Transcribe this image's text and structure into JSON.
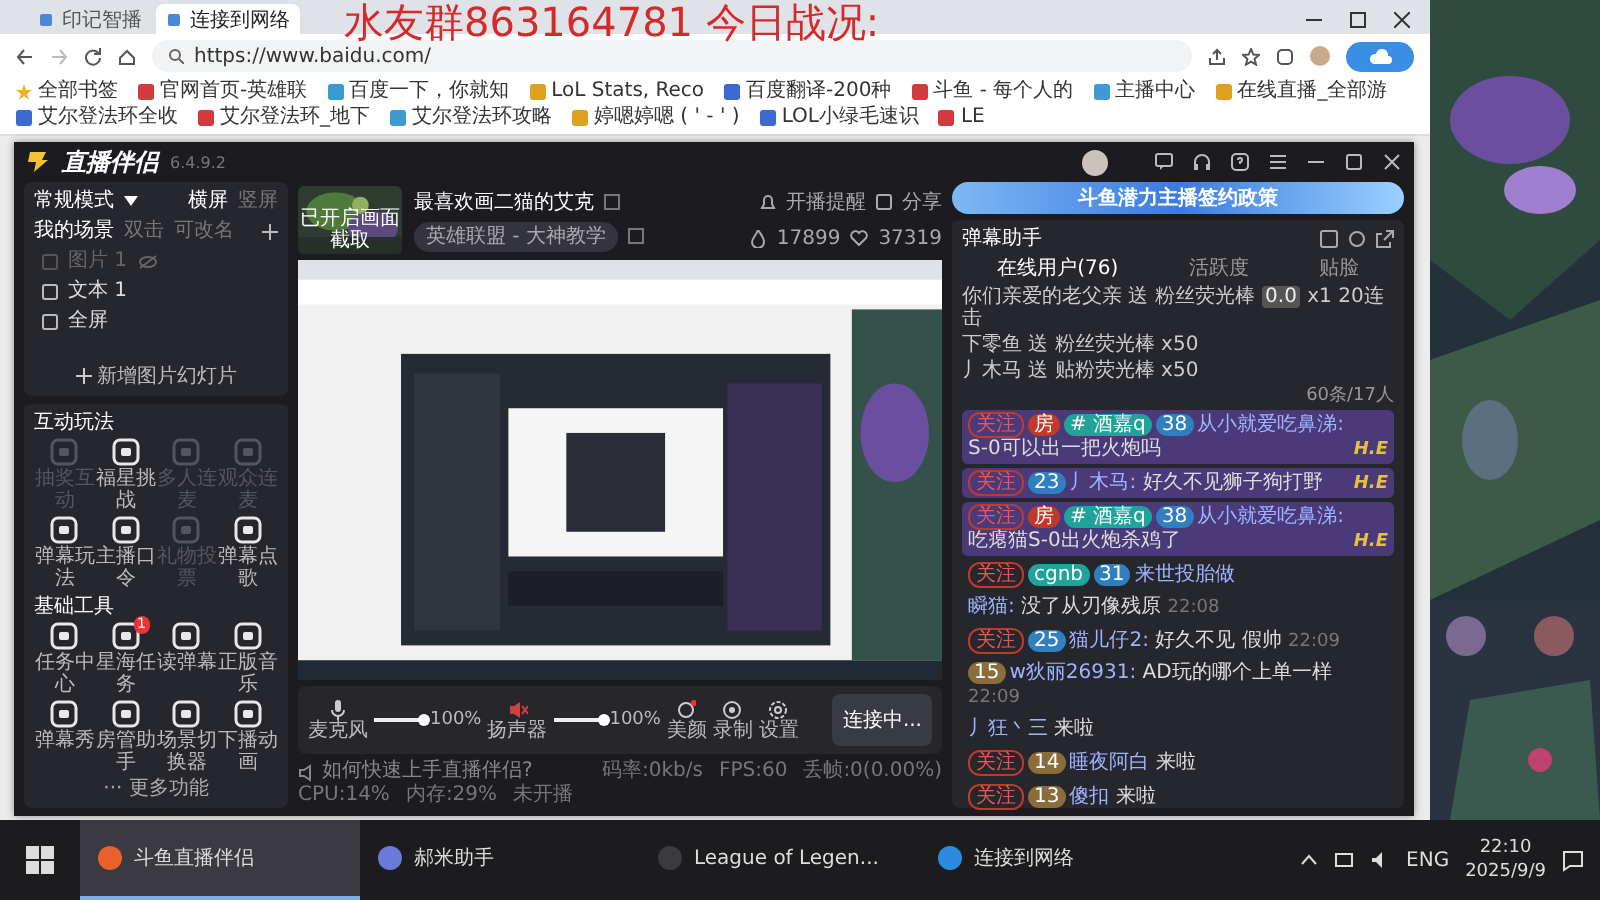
{
  "overlay_text": "水友群863164781 今日战况:",
  "browser": {
    "tabs": [
      {
        "label": "印记智播",
        "selected": false
      },
      {
        "label": "连接到网络",
        "selected": true
      }
    ],
    "url": "https://www.baidu.com/",
    "bookmarks": [
      "全部书签",
      "官网首页-英雄联",
      "百度一下，你就知",
      "LoL Stats, Reco",
      "百度翻译-200种",
      "斗鱼 - 每个人的",
      "主播中心",
      "在线直播_全部游",
      "艾尔登法环全收",
      "艾尔登法环_地下",
      "艾尔登法环攻略",
      "婷嗯婷嗯 ( ' - ' )",
      "LOL小绿毛速识",
      "LE"
    ]
  },
  "app": {
    "name": "直播伴侣",
    "version": "6.4.9.2",
    "mode": "常规模式",
    "orientations": [
      {
        "label": "横屏",
        "selected": true
      },
      {
        "label": "竖屏",
        "selected": false
      }
    ],
    "scene_tabs": [
      {
        "label": "我的场景",
        "selected": true
      },
      {
        "label": "双击",
        "selected": false
      },
      {
        "label": "可改名",
        "selected": false
      }
    ],
    "sources": [
      {
        "name": "图片 1",
        "visible": false
      },
      {
        "name": "文本 1",
        "visible": true
      },
      {
        "name": "全屏",
        "visible": true
      }
    ],
    "add_source": "新增图片幻灯片",
    "sections": [
      {
        "title": "互动玩法",
        "tools": [
          {
            "label": "抽奖互动",
            "disabled": true
          },
          {
            "label": "福星挑战",
            "disabled": false
          },
          {
            "label": "多人连麦",
            "disabled": true
          },
          {
            "label": "观众连麦",
            "disabled": true
          },
          {
            "label": "弹幕玩法",
            "disabled": false
          },
          {
            "label": "主播口令",
            "disabled": false
          },
          {
            "label": "礼物投票",
            "disabled": true
          },
          {
            "label": "弹幕点歌",
            "disabled": false
          }
        ]
      },
      {
        "title": "基础工具",
        "tools": [
          {
            "label": "任务中心",
            "disabled": false
          },
          {
            "label": "星海任务",
            "disabled": false,
            "badge": "1"
          },
          {
            "label": "读弹幕",
            "disabled": false
          },
          {
            "label": "正版音乐",
            "disabled": false
          },
          {
            "label": "弹幕秀",
            "disabled": false
          },
          {
            "label": "房管助手",
            "disabled": false
          },
          {
            "label": "场景切换器",
            "disabled": false
          },
          {
            "label": "下播动画",
            "disabled": false
          }
        ]
      }
    ],
    "more": "··· 更多功能",
    "stream": {
      "thumb_label": "已开启画面截取",
      "title": "最喜欢画二猫的艾克",
      "category": "英雄联盟 - 大神教学",
      "actions": [
        "开播提醒",
        "分享"
      ],
      "hot": "17899",
      "likes": "37319"
    },
    "audio": [
      {
        "label": "麦克风",
        "level": 1,
        "reading": "100%"
      },
      {
        "label": "扬声器",
        "level": 1,
        "reading": "100%"
      }
    ],
    "tools": [
      "美颜",
      "录制",
      "设置"
    ],
    "connect": "连接中...",
    "help": "如何快速上手直播伴侣?",
    "stats": [
      "码率:0kb/s",
      "FPS:60",
      "丢帧:0(0.00%)",
      "CPU:14%",
      "内存:29%",
      "未开播"
    ]
  },
  "chat": {
    "banner": "斗鱼潜力主播签约政策",
    "title": "弹幕助手",
    "tabs": [
      {
        "label": "在线用户(76)",
        "selected": true
      },
      {
        "label": "活跃度",
        "selected": false
      },
      {
        "label": "贴脸",
        "selected": false
      }
    ],
    "gifts": [
      {
        "text": "你们亲爱的老父亲 送 粉丝荧光棒",
        "price": "0.0",
        "count": "x1 20连击"
      },
      {
        "text": "下零鱼 送 粉丝荧光棒",
        "count": "x50"
      },
      {
        "text": "丿木马 送 贴粉荧光棒",
        "count": "x50"
      }
    ],
    "count": "60条/17人",
    "messages": [
      {
        "highlight": true,
        "badges": [
          {
            "kind": "follow",
            "text": "关注"
          },
          {
            "kind": "room",
            "text": "房"
          },
          {
            "kind": "fan",
            "text": "# 酒嘉q"
          },
          {
            "kind": "level",
            "text": "38"
          }
        ],
        "user": "从小就爱吃鼻涕:",
        "text": "S-0可以出一把火炮吗",
        "sign": "H.E"
      },
      {
        "highlight": true,
        "badges": [
          {
            "kind": "follow",
            "text": "关注"
          },
          {
            "kind": "level",
            "text": "23"
          }
        ],
        "user": "丿木马:",
        "text": "好久不见狮子狗打野",
        "sign": "H.E"
      },
      {
        "highlight": true,
        "badges": [
          {
            "kind": "follow",
            "text": "关注"
          },
          {
            "kind": "room",
            "text": "房"
          },
          {
            "kind": "fan",
            "text": "# 酒嘉q"
          },
          {
            "kind": "level",
            "text": "38"
          }
        ],
        "user": "从小就爱吃鼻涕:",
        "text": "吃瘪猫S-0出火炮杀鸡了",
        "sign": "H.E"
      },
      {
        "highlight": false,
        "badges": [
          {
            "kind": "follow",
            "text": "关注"
          },
          {
            "kind": "fan",
            "text": "cgnb"
          },
          {
            "kind": "level",
            "text": "31"
          }
        ],
        "user": "来世投胎做"
      },
      {
        "highlight": false,
        "user": "瞬猫:",
        "text": "没了从刃像残原",
        "time": "22:08"
      },
      {
        "highlight": false,
        "badges": [
          {
            "kind": "follow",
            "text": "关注"
          },
          {
            "kind": "level",
            "text": "25"
          }
        ],
        "user": "猫儿仔2:",
        "text": "好久不见 假帅",
        "time": "22:09"
      },
      {
        "highlight": false,
        "badges": [
          {
            "kind": "noble",
            "text": "15"
          }
        ],
        "user": "w狄丽26931:",
        "text": "AD玩的哪个上单一样",
        "time": "22:09"
      },
      {
        "highlight": false,
        "user": "丿狂丶三",
        "text": "来啦"
      },
      {
        "highlight": false,
        "badges": [
          {
            "kind": "follow",
            "text": "关注"
          },
          {
            "kind": "noble",
            "text": "14"
          }
        ],
        "user": "睡夜阿白",
        "text": "来啦"
      },
      {
        "highlight": false,
        "badges": [
          {
            "kind": "follow",
            "text": "关注"
          },
          {
            "kind": "noble",
            "text": "13"
          }
        ],
        "user": "傻扣",
        "text": "来啦"
      }
    ]
  },
  "taskbar": {
    "items": [
      {
        "label": "斗鱼直播伴侣",
        "selected": true
      },
      {
        "label": "郝米助手",
        "selected": false
      },
      {
        "label": "League of Legen...",
        "selected": false
      },
      {
        "label": "连接到网络",
        "selected": false
      }
    ],
    "lang": "ENG",
    "time": "22:10",
    "date": "2025/9/9"
  }
}
